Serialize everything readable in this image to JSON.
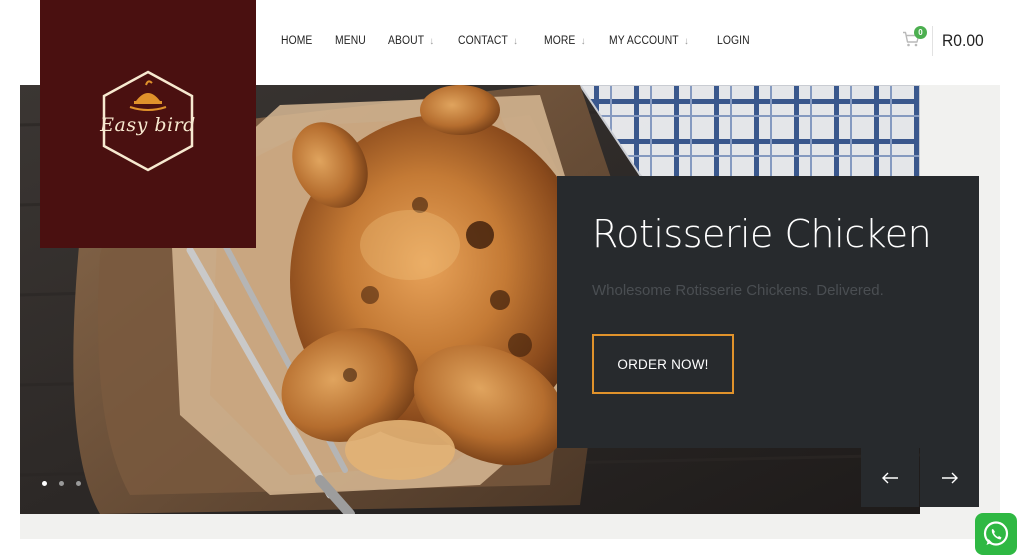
{
  "logo": {
    "text": "Easy bird"
  },
  "nav": [
    {
      "label": "HOME",
      "dropdown": false
    },
    {
      "label": "MENU",
      "dropdown": false
    },
    {
      "label": "ABOUT",
      "dropdown": true
    },
    {
      "label": "CONTACT",
      "dropdown": true
    },
    {
      "label": "MORE",
      "dropdown": true
    },
    {
      "label": "MY ACCOUNT",
      "dropdown": true
    },
    {
      "label": "LOGIN",
      "dropdown": false
    }
  ],
  "cart": {
    "count": "0",
    "total": "R0.00",
    "icon": "cart-icon"
  },
  "hero": {
    "title": "Rotisserie Chicken",
    "subtitle": "Wholesome Rotisserie Chickens. Delivered.",
    "cta": "ORDER NOW!",
    "prev_icon": "arrow-left-icon",
    "next_icon": "arrow-right-icon",
    "slides": 3,
    "active_slide": 1
  },
  "colors": {
    "logo_bg": "#4a1010",
    "card_bg": "#272a2d",
    "accent": "#e0922b",
    "whatsapp": "#2fb843"
  },
  "whatsapp": {
    "icon": "whatsapp-icon"
  }
}
